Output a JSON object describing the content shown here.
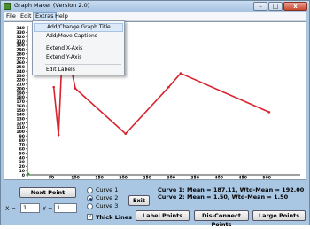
{
  "window": {
    "title": "Graph Maker (Version 2.0)",
    "minimize_glyph": "–",
    "maximize_glyph": "□",
    "close_glyph": "x"
  },
  "menubar": {
    "items": [
      {
        "label": "File"
      },
      {
        "label": "Edit"
      },
      {
        "label": "Extras"
      },
      {
        "label": "Help"
      }
    ]
  },
  "extras_menu": {
    "items": [
      {
        "label": "Add/Change  Graph Title"
      },
      {
        "label": "Add/Move  Captions"
      },
      {
        "label": "Extend X-Axis"
      },
      {
        "label": "Extend Y-Axis"
      },
      {
        "label": "Edit Labels"
      }
    ]
  },
  "chart_data": {
    "type": "line",
    "y_ticks": [
      0,
      10,
      20,
      30,
      40,
      50,
      60,
      70,
      80,
      90,
      100,
      110,
      120,
      130,
      140,
      150,
      160,
      170,
      180,
      190,
      200,
      210,
      220,
      230,
      240,
      250,
      260,
      270,
      280,
      290,
      300,
      310,
      320,
      330,
      340
    ],
    "x_ticks": [
      0,
      50,
      100,
      150,
      200,
      250,
      300,
      350,
      400,
      450,
      500
    ],
    "xlim": [
      0,
      570
    ],
    "ylim": [
      0,
      345
    ],
    "series": [
      {
        "points": [
          [
            55,
            203
          ],
          [
            65,
            92
          ],
          [
            75,
            340
          ],
          [
            100,
            200
          ],
          [
            205,
            95
          ],
          [
            295,
            203
          ],
          [
            320,
            235
          ],
          [
            505,
            145
          ]
        ],
        "color": "#d9232e"
      }
    ]
  },
  "controls": {
    "next_point": "Next Point",
    "x_label": "X =",
    "x_value": "1",
    "y_label": "Y =",
    "y_value": "1",
    "curves": [
      {
        "label": "Curve 1",
        "selected": false
      },
      {
        "label": "Curve 2",
        "selected": true
      },
      {
        "label": "Curve 3",
        "selected": false
      }
    ],
    "exit": "Exit",
    "thick_lines": "Thick Lines",
    "thick_lines_checked": true,
    "check_mark": "✓",
    "stats": [
      {
        "label": "Curve 1:",
        "text": "Mean = 187.11,   Wtd-Mean = 192.00"
      },
      {
        "label": "Curve 2:",
        "text": "Mean = 1.50,   Wtd-Mean = 1.50"
      }
    ],
    "label_points": "Label Points",
    "disconnect_points": "Dis-Connect Points",
    "large_points": "Large Points"
  }
}
